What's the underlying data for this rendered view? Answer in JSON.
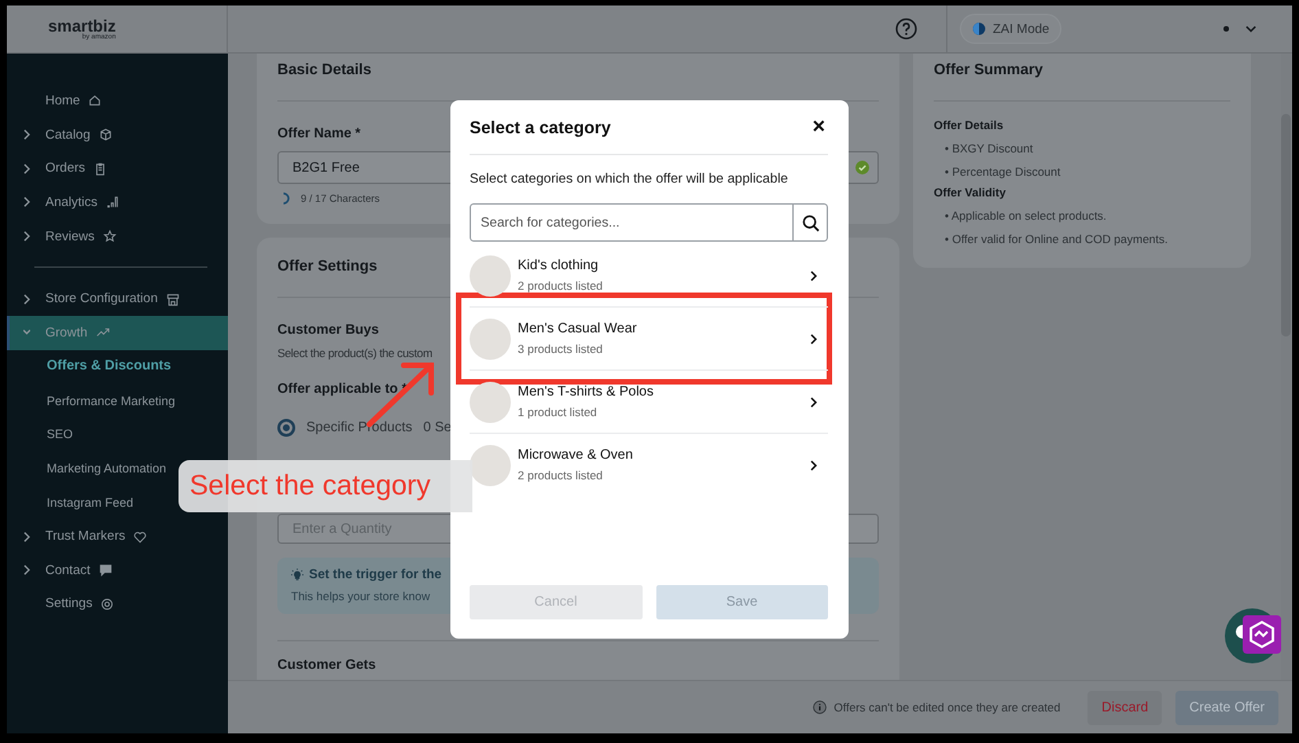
{
  "top_bar": {
    "logo": "smartbiz",
    "logo_sub": "by amazon",
    "mode_label": "ZAI Mode"
  },
  "sidebar": {
    "sections": [
      {
        "items": [
          {
            "label": "Home",
            "kind": "link",
            "selected": false
          },
          {
            "label": "Catalog",
            "kind": "group",
            "expanded": false,
            "selected": false
          },
          {
            "label": "Orders",
            "kind": "group",
            "expanded": false,
            "selected": false
          },
          {
            "label": "Analytics",
            "kind": "group",
            "expanded": false,
            "selected": false
          },
          {
            "label": "Reviews",
            "kind": "group",
            "expanded": false,
            "selected": false
          }
        ]
      },
      {
        "items": [
          {
            "label": "Store Configuration",
            "kind": "group",
            "expanded": false,
            "selected": false
          },
          {
            "label": "Growth",
            "kind": "group",
            "expanded": true,
            "selected": true,
            "children": [
              {
                "label": "Offers & Discounts",
                "selected": true
              },
              {
                "label": "Performance Marketing",
                "selected": false
              },
              {
                "label": "SEO",
                "selected": false
              },
              {
                "label": "Marketing Automation",
                "selected": false
              },
              {
                "label": "Instagram Feed",
                "selected": false
              }
            ]
          },
          {
            "label": "Trust Markers",
            "kind": "group",
            "expanded": false,
            "selected": false
          },
          {
            "label": "Contact",
            "kind": "group",
            "expanded": false,
            "selected": false
          },
          {
            "label": "Settings",
            "kind": "link",
            "selected": false
          }
        ]
      }
    ]
  },
  "basic_details": {
    "title": "Basic Details",
    "offer_name_label": "Offer Name *",
    "offer_name_value": "B2G1 Free",
    "char_count": "9 / 17 Characters"
  },
  "offer_settings": {
    "title": "Offer Settings",
    "customer_buys_title": "Customer Buys",
    "customer_buys_desc": "Select the product(s) the custom",
    "applicable_label": "Offer applicable to *",
    "radio": {
      "label": "Specific Products",
      "selected": true
    },
    "selection_count": "0 Se",
    "quantity_placeholder": "Enter a Quantity",
    "hint_title": "Set the trigger for the",
    "hint_text": "This helps your store know",
    "customer_gets_title": "Customer Gets"
  },
  "summary": {
    "title": "Offer Summary",
    "sections": [
      {
        "heading": "Offer Details",
        "bullets": [
          "• BXGY Discount",
          "• Percentage Discount"
        ]
      },
      {
        "heading": "Offer Validity",
        "bullets": [
          "• Applicable on select products.",
          "• Offer valid for Online and COD payments."
        ]
      }
    ]
  },
  "footer": {
    "notice": "Offers can't be edited once they are created",
    "buttons": [
      {
        "label": "Discard",
        "kind": "danger",
        "disabled": false
      },
      {
        "label": "Create Offer",
        "kind": "primary",
        "disabled": true
      }
    ]
  },
  "modal": {
    "title": "Select a category",
    "close": "×",
    "subtitle": "Select categories on which the offer will be applicable",
    "search_placeholder": "Search for categories...",
    "categories": [
      {
        "name": "Kid's clothing",
        "count": "2 products listed",
        "highlighted": false
      },
      {
        "name": "Men's Casual Wear",
        "count": "3 products listed",
        "highlighted": true
      },
      {
        "name": "Men's T-shirts & Polos",
        "count": "1 product listed",
        "highlighted": false
      },
      {
        "name": "Microwave & Oven",
        "count": "2 products listed",
        "highlighted": false
      }
    ],
    "buttons": [
      {
        "label": "Cancel",
        "kind": "secondary",
        "disabled": true
      },
      {
        "label": "Save",
        "kind": "primary",
        "disabled": true
      }
    ]
  },
  "annotation": {
    "label": "Select the category"
  }
}
